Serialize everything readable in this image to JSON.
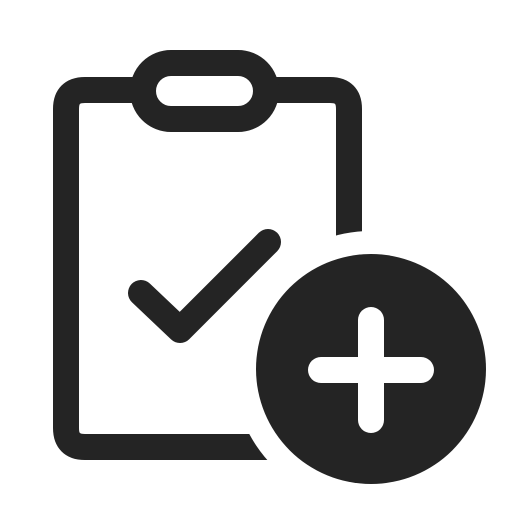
{
  "icon": {
    "name": "clipboard-check-add-icon",
    "components": [
      "clipboard-icon",
      "clipboard-clip-icon",
      "checkmark-icon",
      "add-badge-icon",
      "plus-icon"
    ],
    "colors": {
      "foreground": "#242424",
      "background": "#ffffff"
    }
  }
}
